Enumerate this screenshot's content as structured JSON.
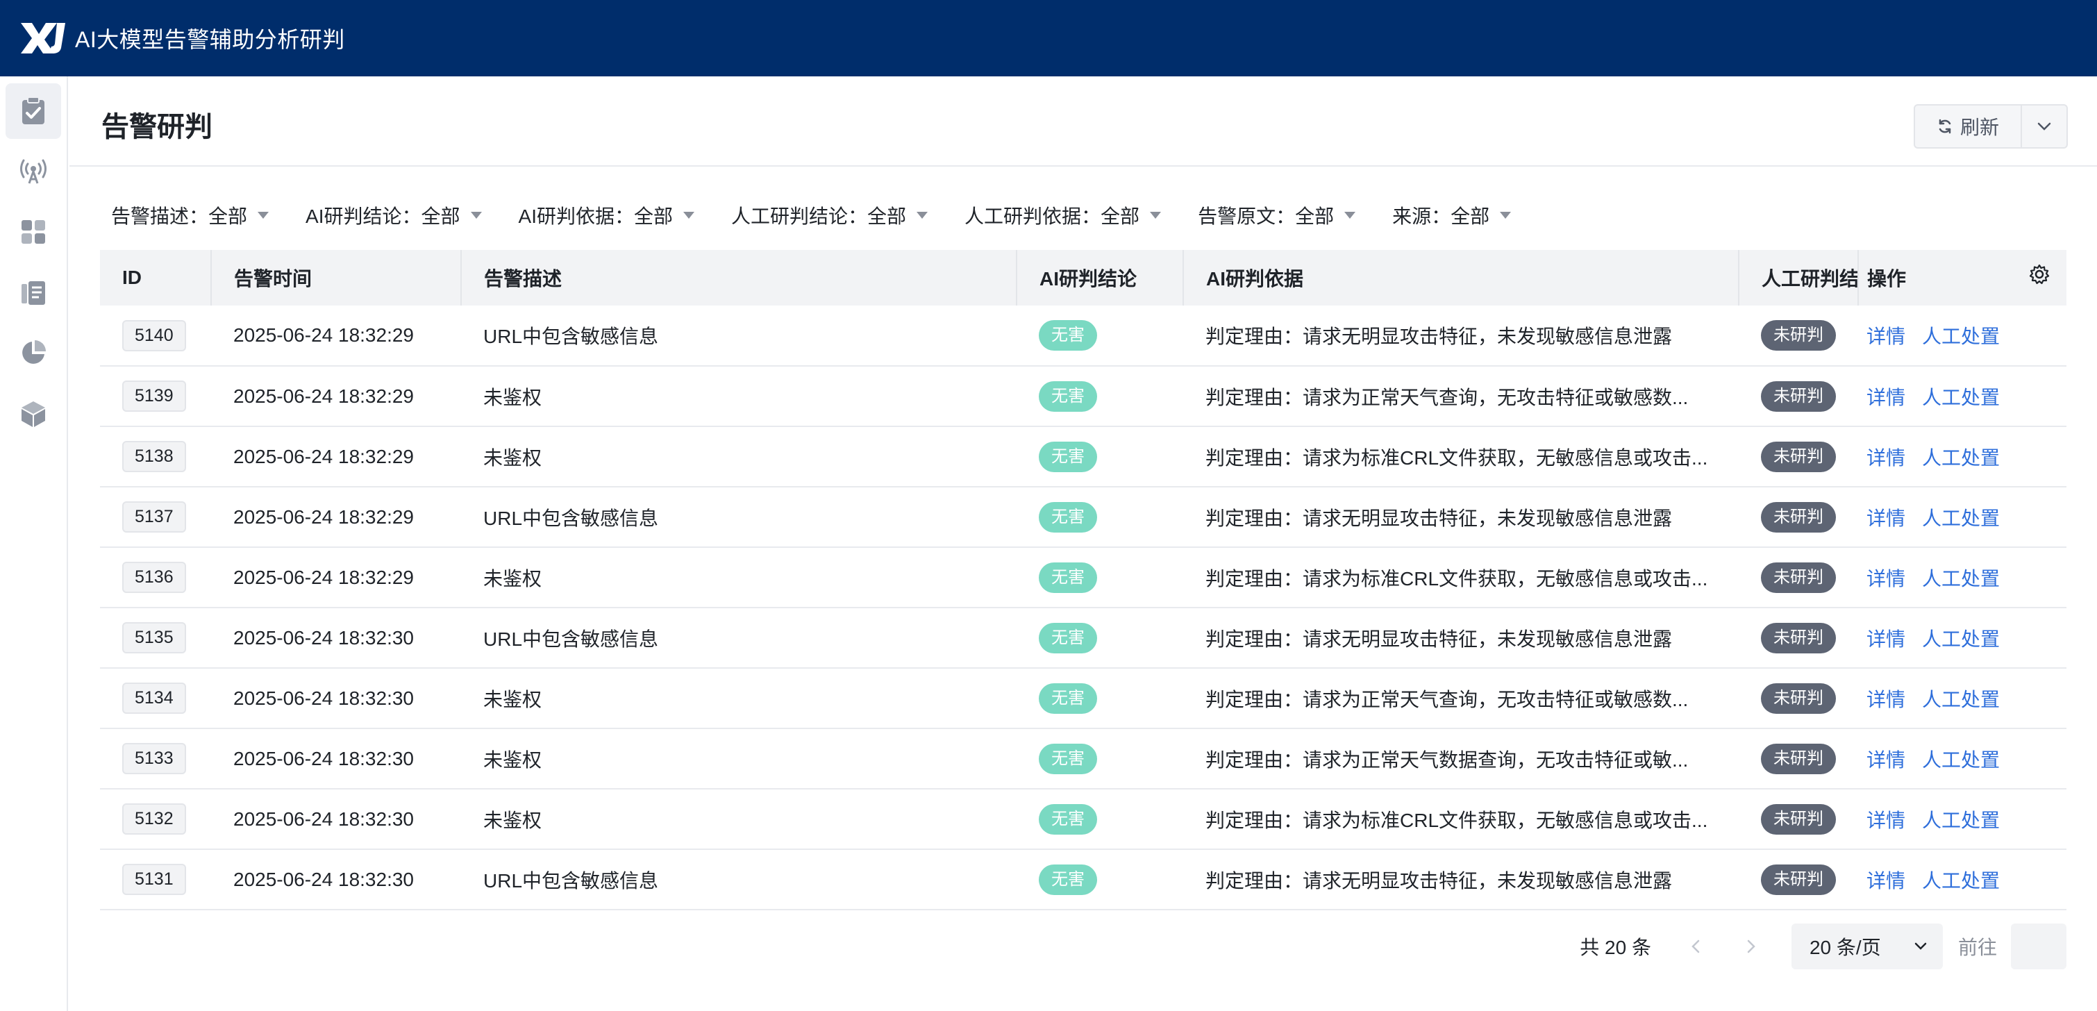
{
  "app": {
    "title": "AI大模型告警辅助分析研判"
  },
  "sidebar": {
    "items": [
      {
        "name": "clipboard-check-icon",
        "active": true
      },
      {
        "name": "broadcast-icon",
        "active": false
      },
      {
        "name": "grid-icon",
        "active": false
      },
      {
        "name": "list-document-icon",
        "active": false
      },
      {
        "name": "pie-chart-icon",
        "active": false
      },
      {
        "name": "cube-icon",
        "active": false
      }
    ]
  },
  "page": {
    "title": "告警研判"
  },
  "toolbar": {
    "refresh_label": "刷新"
  },
  "filters": [
    {
      "label": "告警描述：",
      "value": "全部"
    },
    {
      "label": "AI研判结论：",
      "value": "全部"
    },
    {
      "label": "AI研判依据：",
      "value": "全部"
    },
    {
      "label": "人工研判结论：",
      "value": "全部"
    },
    {
      "label": "人工研判依据：",
      "value": "全部"
    },
    {
      "label": "告警原文：",
      "value": "全部"
    },
    {
      "label": "来源：",
      "value": "全部"
    }
  ],
  "table": {
    "columns": [
      "ID",
      "告警时间",
      "告警描述",
      "AI研判结论",
      "AI研判依据",
      "人工研判结",
      "操作"
    ],
    "rows": [
      {
        "id": "5140",
        "time": "2025-06-24 18:32:29",
        "desc": "URL中包含敏感信息",
        "ai": "无害",
        "basis": "判定理由：请求无明显攻击特征，未发现敏感信息泄露",
        "human": "未研判"
      },
      {
        "id": "5139",
        "time": "2025-06-24 18:32:29",
        "desc": "未鉴权",
        "ai": "无害",
        "basis": "判定理由：请求为正常天气查询，无攻击特征或敏感数...",
        "human": "未研判"
      },
      {
        "id": "5138",
        "time": "2025-06-24 18:32:29",
        "desc": "未鉴权",
        "ai": "无害",
        "basis": "判定理由：请求为标准CRL文件获取，无敏感信息或攻击...",
        "human": "未研判"
      },
      {
        "id": "5137",
        "time": "2025-06-24 18:32:29",
        "desc": "URL中包含敏感信息",
        "ai": "无害",
        "basis": "判定理由：请求无明显攻击特征，未发现敏感信息泄露",
        "human": "未研判"
      },
      {
        "id": "5136",
        "time": "2025-06-24 18:32:29",
        "desc": "未鉴权",
        "ai": "无害",
        "basis": "判定理由：请求为标准CRL文件获取，无敏感信息或攻击...",
        "human": "未研判"
      },
      {
        "id": "5135",
        "time": "2025-06-24 18:32:30",
        "desc": "URL中包含敏感信息",
        "ai": "无害",
        "basis": "判定理由：请求无明显攻击特征，未发现敏感信息泄露",
        "human": "未研判"
      },
      {
        "id": "5134",
        "time": "2025-06-24 18:32:30",
        "desc": "未鉴权",
        "ai": "无害",
        "basis": "判定理由：请求为正常天气查询，无攻击特征或敏感数...",
        "human": "未研判"
      },
      {
        "id": "5133",
        "time": "2025-06-24 18:32:30",
        "desc": "未鉴权",
        "ai": "无害",
        "basis": "判定理由：请求为正常天气数据查询，无攻击特征或敏...",
        "human": "未研判"
      },
      {
        "id": "5132",
        "time": "2025-06-24 18:32:30",
        "desc": "未鉴权",
        "ai": "无害",
        "basis": "判定理由：请求为标准CRL文件获取，无敏感信息或攻击...",
        "human": "未研判"
      },
      {
        "id": "5131",
        "time": "2025-06-24 18:32:30",
        "desc": "URL中包含敏感信息",
        "ai": "无害",
        "basis": "判定理由：请求无明显攻击特征，未发现敏感信息泄露",
        "human": "未研判"
      }
    ],
    "actions": {
      "detail": "详情",
      "manual": "人工处置"
    }
  },
  "pagination": {
    "total_label": "共 20 条",
    "page_size_label": "20 条/页",
    "goto_label": "前往",
    "goto_value": ""
  },
  "colors": {
    "topbar": "#002d6b",
    "tag_safe": "#7ad9c2",
    "tag_pending": "#5d6473",
    "link": "#2f6fdb"
  }
}
